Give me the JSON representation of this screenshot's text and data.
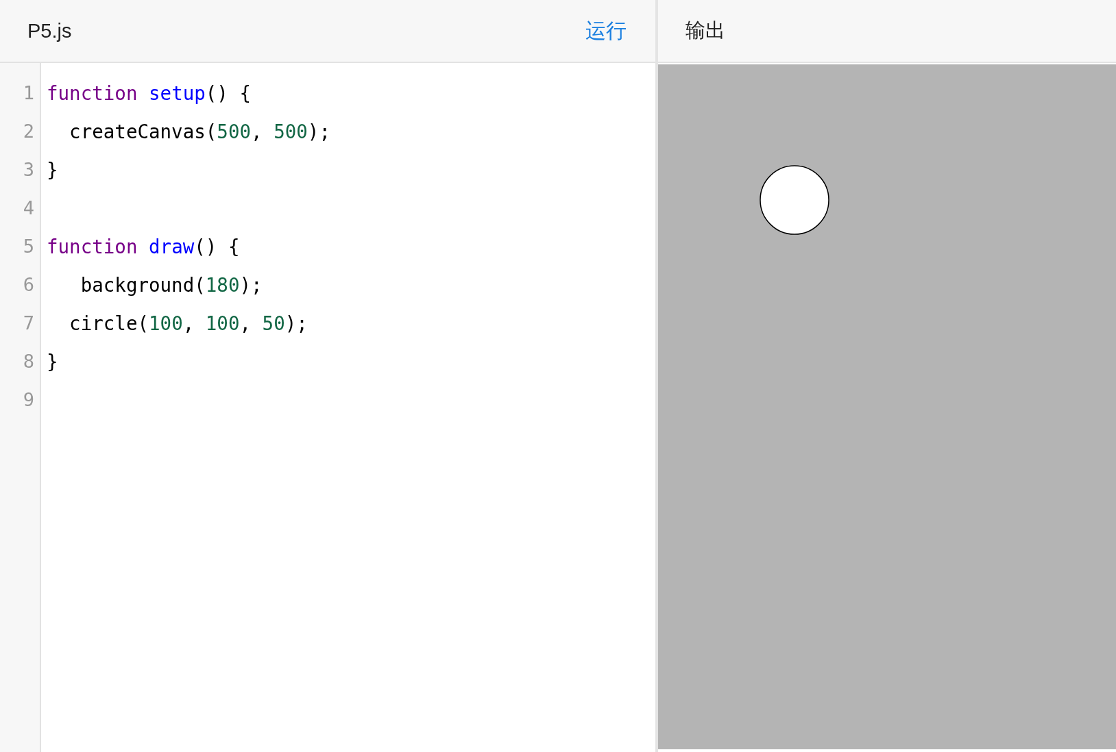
{
  "editor": {
    "title": "P5.js",
    "run_button": "运行",
    "lines": [
      {
        "number": "1",
        "tokens": [
          {
            "kind": "keyword",
            "text": "function "
          },
          {
            "kind": "def",
            "text": "setup"
          },
          {
            "kind": "plain",
            "text": "() {"
          }
        ]
      },
      {
        "number": "2",
        "tokens": [
          {
            "kind": "plain",
            "text": "  createCanvas("
          },
          {
            "kind": "number",
            "text": "500"
          },
          {
            "kind": "plain",
            "text": ", "
          },
          {
            "kind": "number",
            "text": "500"
          },
          {
            "kind": "plain",
            "text": ");"
          }
        ]
      },
      {
        "number": "3",
        "tokens": [
          {
            "kind": "plain",
            "text": "}"
          }
        ]
      },
      {
        "number": "4"
      },
      {
        "number": "5",
        "tokens": [
          {
            "kind": "keyword",
            "text": "function "
          },
          {
            "kind": "def",
            "text": "draw"
          },
          {
            "kind": "plain",
            "text": "() {"
          }
        ]
      },
      {
        "number": "6",
        "tokens": [
          {
            "kind": "plain",
            "text": "   background("
          },
          {
            "kind": "number",
            "text": "180"
          },
          {
            "kind": "plain",
            "text": ");"
          }
        ]
      },
      {
        "number": "7",
        "tokens": [
          {
            "kind": "plain",
            "text": "  circle("
          },
          {
            "kind": "number",
            "text": "100"
          },
          {
            "kind": "plain",
            "text": ", "
          },
          {
            "kind": "number",
            "text": "100"
          },
          {
            "kind": "plain",
            "text": ", "
          },
          {
            "kind": "number",
            "text": "50"
          },
          {
            "kind": "plain",
            "text": ");"
          }
        ]
      },
      {
        "number": "8",
        "tokens": [
          {
            "kind": "plain",
            "text": "}"
          }
        ]
      },
      {
        "number": "9"
      }
    ]
  },
  "output": {
    "title": "输出"
  }
}
